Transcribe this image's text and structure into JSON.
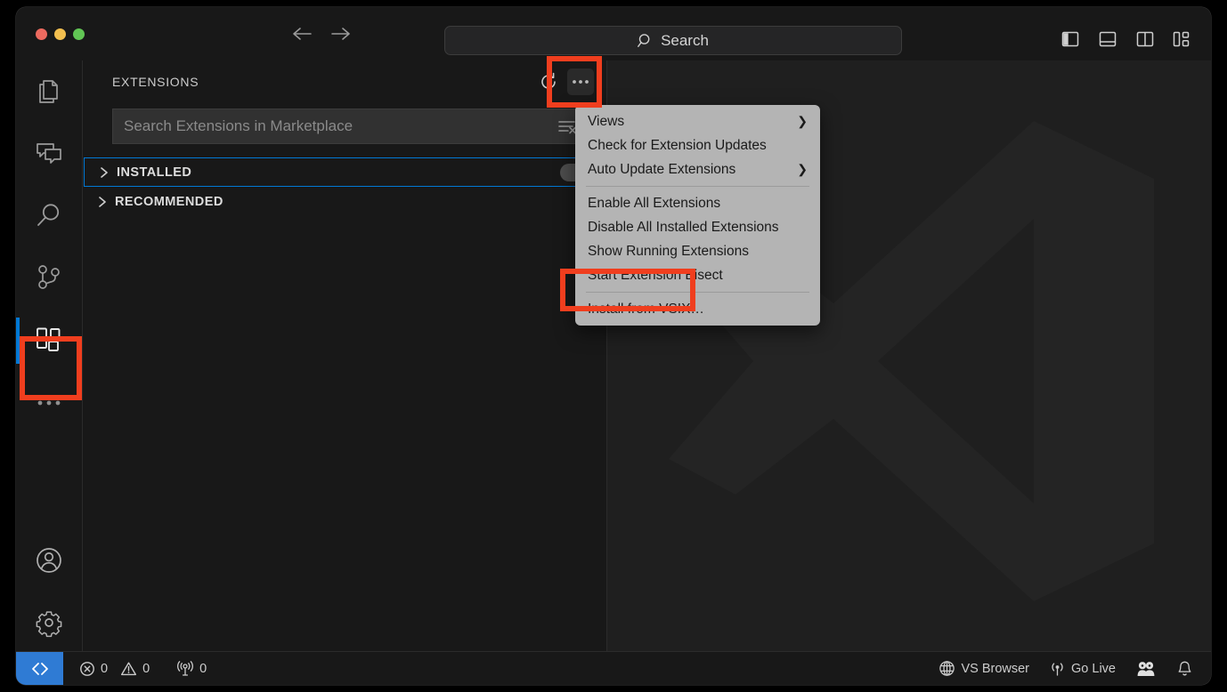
{
  "window": {
    "traffic_lights": [
      "close",
      "minimize",
      "maximize"
    ],
    "nav_back_icon": "arrow-left-icon",
    "nav_forward_icon": "arrow-right-icon"
  },
  "command_center": {
    "icon": "search-icon",
    "label": "Search",
    "placeholder": "Search"
  },
  "layout_actions": [
    {
      "name": "toggle-primary-sidebar",
      "icon": "layout-sidebar-left-icon"
    },
    {
      "name": "toggle-panel",
      "icon": "layout-panel-bottom-icon"
    },
    {
      "name": "toggle-secondary-sidebar",
      "icon": "layout-sidebar-right-icon"
    },
    {
      "name": "customize-layout",
      "icon": "layout-customize-icon"
    }
  ],
  "activity_bar": {
    "items": [
      {
        "name": "explorer",
        "icon": "files-icon",
        "active": false
      },
      {
        "name": "chat",
        "icon": "chat-icon",
        "active": false
      },
      {
        "name": "search",
        "icon": "search-icon",
        "active": false
      },
      {
        "name": "source-control",
        "icon": "source-control-icon",
        "active": false
      },
      {
        "name": "extensions",
        "icon": "extensions-icon",
        "active": true
      },
      {
        "name": "more-views",
        "icon": "ellipsis-icon",
        "active": false
      }
    ],
    "bottom_items": [
      {
        "name": "accounts",
        "icon": "account-icon"
      },
      {
        "name": "manage-settings",
        "icon": "gear-icon"
      }
    ]
  },
  "sidebar": {
    "title": "EXTENSIONS",
    "actions": [
      {
        "name": "refresh",
        "icon": "refresh-icon",
        "label": "Refresh"
      },
      {
        "name": "more-actions",
        "icon": "ellipsis-icon",
        "label": "Views and More Actions..."
      }
    ],
    "search": {
      "placeholder": "Search Extensions in Marketplace",
      "value": "",
      "clear_icon": "clear-filter-icon"
    },
    "sections": [
      {
        "name": "installed",
        "label": "INSTALLED",
        "expanded": false,
        "focused": true,
        "badge": ""
      },
      {
        "name": "recommended",
        "label": "RECOMMENDED",
        "expanded": false,
        "focused": false,
        "badge": ""
      }
    ]
  },
  "context_menu": {
    "items": [
      {
        "label": "Views",
        "submenu": true,
        "separator_after": false,
        "highlighted": false
      },
      {
        "label": "Check for Extension Updates",
        "submenu": false,
        "separator_after": false,
        "highlighted": false
      },
      {
        "label": "Auto Update Extensions",
        "submenu": true,
        "separator_after": true,
        "highlighted": false
      },
      {
        "label": "Enable All Extensions",
        "submenu": false,
        "separator_after": false,
        "highlighted": false
      },
      {
        "label": "Disable All Installed Extensions",
        "submenu": false,
        "separator_after": false,
        "highlighted": false
      },
      {
        "label": "Show Running Extensions",
        "submenu": false,
        "separator_after": false,
        "highlighted": false
      },
      {
        "label": "Start Extension Bisect",
        "submenu": false,
        "separator_after": true,
        "highlighted": false
      },
      {
        "label": "Install from VSIX…",
        "submenu": false,
        "separator_after": false,
        "highlighted": true
      }
    ]
  },
  "editor": {
    "watermark_icon": "vscode-logo-watermark"
  },
  "status_bar": {
    "remote": {
      "name": "remote-indicator",
      "icon": "remote-icon",
      "label": ""
    },
    "left_items": [
      {
        "name": "errors",
        "icon": "error-icon",
        "value": "0"
      },
      {
        "name": "warnings",
        "icon": "warning-icon",
        "value": "0"
      },
      {
        "name": "ports",
        "icon": "radio-tower-icon",
        "value": "0"
      }
    ],
    "right_items": [
      {
        "name": "vs-browser",
        "icon": "globe-icon",
        "label": "VS Browser"
      },
      {
        "name": "go-live",
        "icon": "broadcast-icon",
        "label": "Go Live"
      },
      {
        "name": "live-share",
        "icon": "live-share-icon",
        "label": ""
      },
      {
        "name": "notifications",
        "icon": "bell-icon",
        "label": ""
      }
    ]
  },
  "annotations": {
    "boxes": [
      {
        "name": "extensions-activity-icon-highlight",
        "color": "#f03e1e"
      },
      {
        "name": "more-actions-button-highlight",
        "color": "#f03e1e"
      },
      {
        "name": "install-from-vsix-highlight",
        "color": "#f03e1e"
      }
    ]
  }
}
